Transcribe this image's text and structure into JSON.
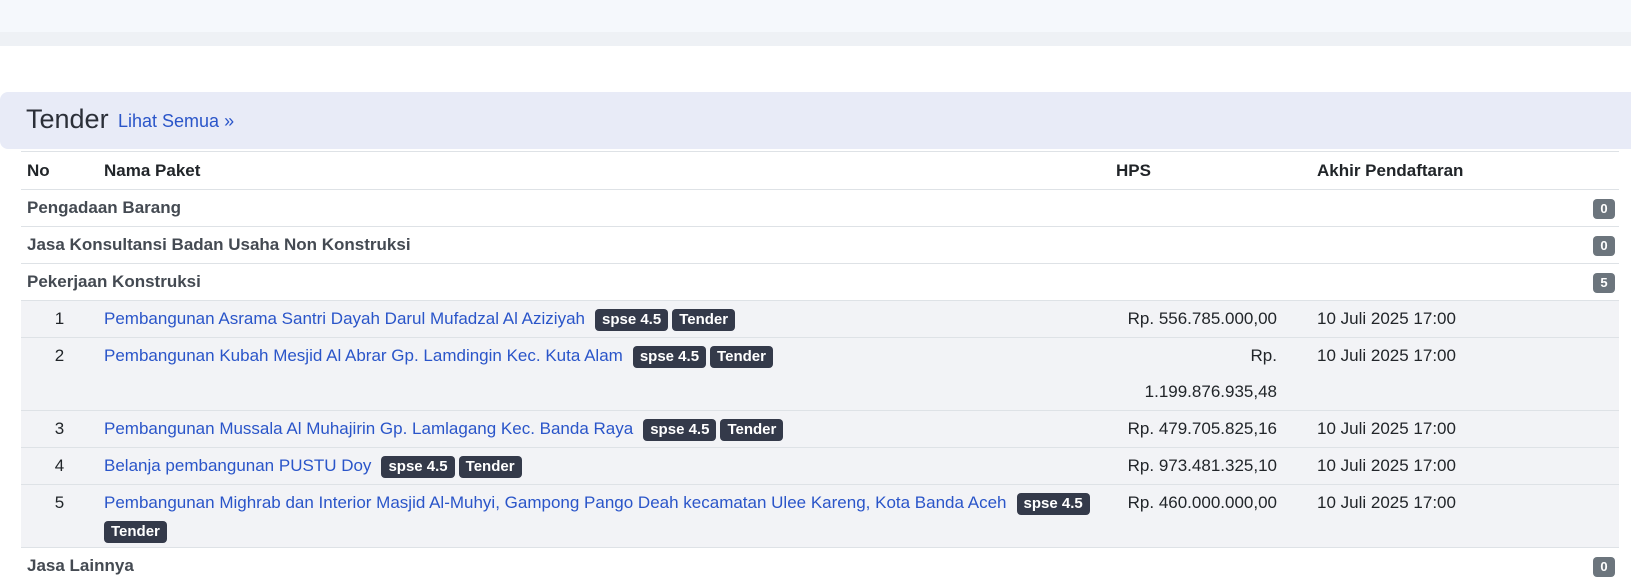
{
  "panel": {
    "title": "Tender",
    "link": "Lihat Semua »"
  },
  "table": {
    "headers": {
      "no": "No",
      "name": "Nama Paket",
      "hps": "HPS",
      "deadline": "Akhir Pendaftaran"
    },
    "groups": [
      {
        "label": "Pengadaan Barang",
        "count": "0"
      },
      {
        "label": "Jasa Konsultansi Badan Usaha Non Konstruksi",
        "count": "0"
      },
      {
        "label": "Pekerjaan Konstruksi",
        "count": "5"
      },
      {
        "label": "Jasa Lainnya",
        "count": "0"
      }
    ],
    "badges": {
      "spse": "spse 4.5",
      "type": "Tender"
    },
    "items": [
      {
        "no": "1",
        "name": "Pembangunan Asrama Santri Dayah Darul Mufadzal Al Aziziyah",
        "hps": "Rp. 556.785.000,00",
        "deadline": "10 Juli 2025 17:00"
      },
      {
        "no": "2",
        "name": "Pembangunan Kubah Mesjid Al Abrar Gp. Lamdingin Kec. Kuta Alam",
        "hps": "Rp. 1.199.876.935,48",
        "deadline": "10 Juli 2025 17:00"
      },
      {
        "no": "3",
        "name": "Pembangunan Mussala Al Muhajirin Gp. Lamlagang Kec. Banda Raya",
        "hps": "Rp. 479.705.825,16",
        "deadline": "10 Juli 2025 17:00"
      },
      {
        "no": "4",
        "name": "Belanja pembangunan PUSTU Doy",
        "hps": "Rp. 973.481.325,10",
        "deadline": "10 Juli 2025 17:00"
      },
      {
        "no": "5",
        "name": "Pembangunan Mighrab dan Interior Masjid Al-Muhyi, Gampong Pango Deah kecamatan Ulee Kareng, Kota Banda Aceh",
        "hps": "Rp. 460.000.000,00",
        "deadline": "10 Juli 2025 17:00"
      }
    ]
  }
}
